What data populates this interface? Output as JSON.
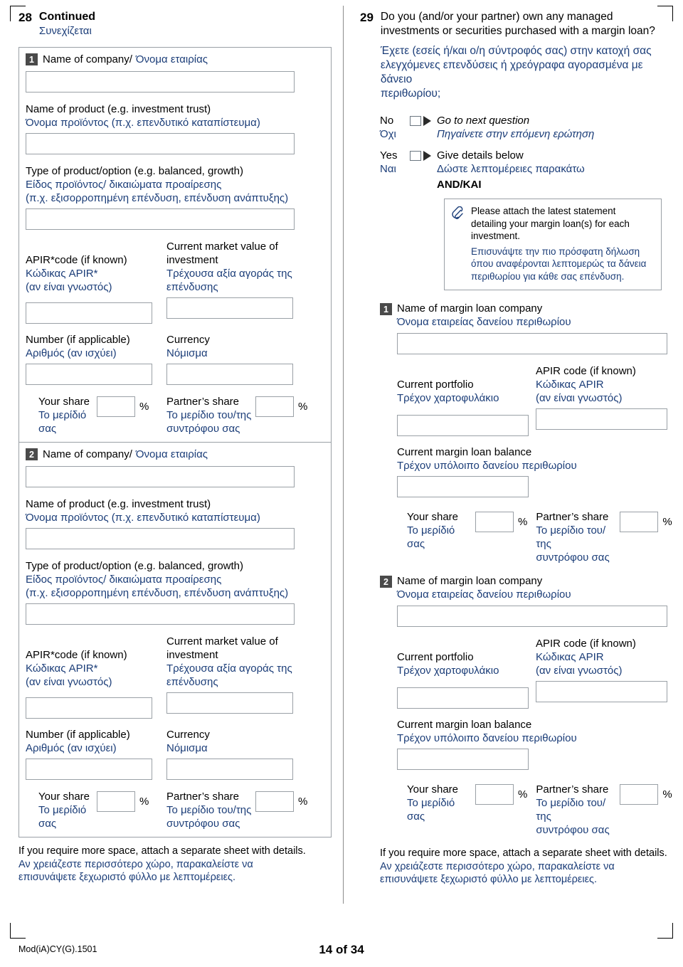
{
  "footer": {
    "mod_code": "Mod(iA)CY(G).1501",
    "page_number": "14 of 34"
  },
  "left": {
    "q_number": "28",
    "title_en": "Continued",
    "title_gr": "Συνεχίζεται",
    "blocks": [
      {
        "index": "1",
        "company_en": "Name of company/",
        "company_gr": "Όνομα εταιρίας",
        "product_en": "Name of product (e.g. investment trust)",
        "product_gr": "Όνομα προϊόντος (π.χ. επενδυτικό καταπίστευμα)",
        "type_en": "Type of product/option (e.g. balanced, growth)",
        "type_gr1": "Είδος προϊόντος/ δικαιώματα προαίρεσης",
        "type_gr2": "(π.χ. εξισορροπημένη επένδυση, επένδυση ανάπτυξης)",
        "apir_en": "APIR*code (if known)",
        "apir_gr1": "Κώδικας APIR*",
        "apir_gr2": "(αν είναι γνωστός)",
        "market_en1": "Current market value of",
        "market_en2": "investment",
        "market_gr1": "Τρέχουσα αξία αγοράς της",
        "market_gr2": "επένδυσης",
        "number_en": "Number (if applicable)",
        "number_gr": "Αριθμός (αν ισχύει)",
        "currency_en": "Currency",
        "currency_gr": "Νόμισμα",
        "your_share_en": "Your share",
        "your_share_gr": "Το μερίδιό σας",
        "partner_share_en": "Partner’s share",
        "partner_share_gr1": "Το μερίδιο του/της",
        "partner_share_gr2": "συντρόφου σας",
        "percent": "%"
      },
      {
        "index": "2",
        "company_en": "Name of company/",
        "company_gr": "Όνομα εταιρίας",
        "product_en": "Name of product (e.g. investment trust)",
        "product_gr": "Όνομα προϊόντος (π.χ. επενδυτικό καταπίστευμα)",
        "type_en": "Type of product/option (e.g. balanced, growth)",
        "type_gr1": "Είδος προϊόντος/ δικαιώματα προαίρεσης",
        "type_gr2": "(π.χ. εξισορροπημένη επένδυση, επένδυση ανάπτυξης)",
        "apir_en": "APIR*code (if known)",
        "apir_gr1": "Κώδικας APIR*",
        "apir_gr2": "(αν είναι γνωστός)",
        "market_en1": "Current market value of",
        "market_en2": "investment",
        "market_gr1": "Τρέχουσα αξία αγοράς της",
        "market_gr2": "επένδυσης",
        "number_en": "Number (if applicable)",
        "number_gr": "Αριθμός (αν ισχύει)",
        "currency_en": "Currency",
        "currency_gr": "Νόμισμα",
        "your_share_en": "Your share",
        "your_share_gr": "Το μερίδιό σας",
        "partner_share_en": "Partner’s share",
        "partner_share_gr1": "Το μερίδιο του/της",
        "partner_share_gr2": "συντρόφου σας",
        "percent": "%"
      }
    ],
    "more_space_en": "If you require more space, attach a separate sheet with details.",
    "more_space_gr1": "Αν χρειάζεστε περισσότερο χώρο, παρακαλείστε να",
    "more_space_gr2": "επισυνάψετε ξεχωριστό φύλλο με λεπτομέρειες."
  },
  "right": {
    "q_number": "29",
    "question_en1": "Do you (and/or your partner) own any managed",
    "question_en2": "investments or securities purchased with a margin loan?",
    "question_gr1": "Έχετε (εσείς ή/και ο/η σύντροφός σας) στην κατοχή σας",
    "question_gr2": "ελεγχόμενες επενδύσεις ή χρεόγραφα αγορασμένα με δάνειο",
    "question_gr3": "περιθωρίου;",
    "no_en": "No",
    "no_gr": "Όχι",
    "no_action_en": "Go to next question",
    "no_action_gr": "Πηγαίνετε στην επόμενη ερώτηση",
    "yes_en": "Yes",
    "yes_gr": "Ναι",
    "yes_action_en": "Give details below",
    "yes_action_gr": "Δώστε λεπτομέρειες παρακάτω",
    "and_label": "AND/ΚΑΙ",
    "note_icon": "paperclip-icon",
    "note_en1": "Please attach the latest statement",
    "note_en2": "detailing your margin loan(s) for each",
    "note_en3": "investment.",
    "note_gr1": "Επισυνάψτε την πιο πρόσφατη δήλωση",
    "note_gr2": "όπου αναφέρονται λεπτομερώς τα δάνεια",
    "note_gr3": "περιθωρίου για κάθε σας επένδυση.",
    "blocks": [
      {
        "index": "1",
        "company_en": "Name of margin loan company",
        "company_gr": "Όνομα εταιρείας δανείου περιθωρίου",
        "portfolio_en": "Current portfolio",
        "portfolio_gr": "Τρέχον χαρτοφυλάκιο",
        "apir_en": "APIR code (if known)",
        "apir_gr1": "Κώδικας APIR",
        "apir_gr2": "(αν είναι γνωστός)",
        "balance_en": "Current margin loan balance",
        "balance_gr": "Τρέχον υπόλοιπο δανείου περιθωρίου",
        "your_share_en": "Your share",
        "your_share_gr": "Το μερίδιό σας",
        "partner_share_en": "Partner’s share",
        "partner_share_gr1": "Το μερίδιο του/της",
        "partner_share_gr2": "συντρόφου σας",
        "percent": "%"
      },
      {
        "index": "2",
        "company_en": "Name of margin loan company",
        "company_gr": "Όνομα εταιρείας δανείου περιθωρίου",
        "portfolio_en": "Current portfolio",
        "portfolio_gr": "Τρέχον χαρτοφυλάκιο",
        "apir_en": "APIR code (if known)",
        "apir_gr1": "Κώδικας APIR",
        "apir_gr2": "(αν είναι γνωστός)",
        "balance_en": "Current margin loan balance",
        "balance_gr": "Τρέχον υπόλοιπο δανείου περιθωρίου",
        "your_share_en": "Your share",
        "your_share_gr": "Το μερίδιό σας",
        "partner_share_en": "Partner’s share",
        "partner_share_gr1": "Το μερίδιο του/της",
        "partner_share_gr2": "συντρόφου σας",
        "percent": "%"
      }
    ],
    "more_space_en": "If you require more space, attach a separate sheet with details.",
    "more_space_gr1": "Αν χρειάζεστε περισσότερο χώρο, παρακαλείστε να",
    "more_space_gr2": "επισυνάψετε ξεχωριστό φύλλο με λεπτομέρειες."
  }
}
